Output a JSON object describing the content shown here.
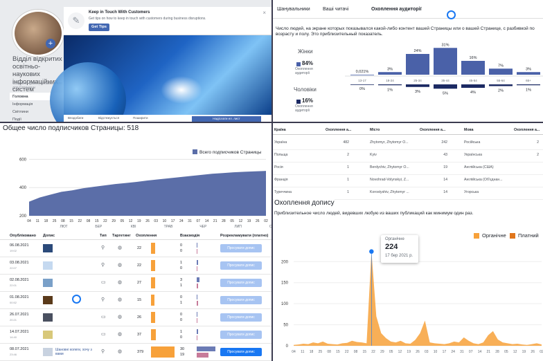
{
  "fb_page": {
    "name": "Відділ відкритих освітньо-наукових інформаційних систем",
    "handle": "Создайте @имя_пользователя для Страницы",
    "nav": [
      "Головна",
      "Інформація",
      "Світлини",
      "Події"
    ],
    "tip": {
      "title": "Keep in Touch With Customers",
      "subtitle": "Get tips on how to keep in touch with customers during business disruptions.",
      "button": "Get Tips"
    },
    "actions": [
      "Вподобати",
      "Відстежується",
      "Поширити",
      "Надіслати ел. лист"
    ],
    "avatar_badge": "+"
  },
  "audience": {
    "tabs": [
      "Шанувальники",
      "Ваші читачі",
      "Охоплення аудиторії"
    ],
    "description": "Число людей, на экране которых показывался какой-либо контент вашей Страницы или о вашей Странице, с разбивкой по возрасту и полу. Это приблизительный показатель.",
    "women": {
      "label": "Жінки",
      "pct": "84%",
      "sub": "Охоплення аудиторії"
    },
    "men": {
      "label": "Чоловіки",
      "pct": "16%",
      "sub": "Охоплення аудиторії"
    },
    "age_groups": [
      "13-17",
      "18-24",
      "25-34",
      "35-44",
      "45-54",
      "55-64",
      "65+"
    ],
    "women_values": [
      "0,021%",
      "3%",
      "24%",
      "31%",
      "16%",
      "7%",
      "3%"
    ],
    "women_nums": [
      0.021,
      3,
      24,
      31,
      16,
      7,
      3
    ],
    "men_values": [
      "0%",
      "1%",
      "3%",
      "5%",
      "4%",
      "2%",
      "1%"
    ],
    "men_nums": [
      0,
      1,
      3,
      5,
      4,
      2,
      1
    ],
    "women_color": "#4a61a8",
    "men_color": "#1c2a63"
  },
  "subscribers": {
    "title": "Общее число подписчиков Страницы: 518",
    "legend": "Всего подписчиков Страницы",
    "months": [
      "ЛЮТ",
      "БЕР",
      "КВІ",
      "ТРАВ",
      "ЧЕР",
      "ЛИП",
      "СЕР"
    ],
    "day_ticks": [
      "04",
      "11",
      "18",
      "25",
      "08",
      "15",
      "22",
      "08",
      "15",
      "22",
      "29",
      "05",
      "12",
      "19",
      "26",
      "03",
      "10",
      "17",
      "24",
      "31",
      "07",
      "14",
      "21",
      "28",
      "05",
      "12",
      "19",
      "26",
      "02"
    ],
    "color": "#5b6ea8"
  },
  "chart_data": [
    {
      "type": "area",
      "title": "Общее число подписчиков Страницы: 518",
      "series": [
        {
          "name": "Всего подписчиков Страницы",
          "values": [
            300,
            330,
            350,
            370,
            380,
            395,
            405,
            415,
            425,
            432,
            440,
            450,
            458,
            466,
            474,
            482,
            490,
            498,
            503,
            508,
            512,
            515,
            518
          ]
        }
      ],
      "ylim": [
        200,
        700
      ],
      "yticks": [
        200,
        400,
        600
      ],
      "legend": "top-right"
    },
    {
      "type": "bar",
      "categories": [
        "13-17",
        "18-24",
        "25-34",
        "35-44",
        "45-54",
        "55-64",
        "65+"
      ],
      "series": [
        {
          "name": "Жінки",
          "values": [
            0.021,
            3,
            24,
            31,
            16,
            7,
            3
          ]
        },
        {
          "name": "Чоловіки",
          "values": [
            0,
            1,
            3,
            5,
            4,
            2,
            1
          ]
        }
      ]
    },
    {
      "type": "area",
      "title": "Охоплення допису",
      "series": [
        {
          "name": "Органічне",
          "values": [
            2,
            3,
            5,
            4,
            8,
            6,
            10,
            5,
            4,
            3,
            6,
            7,
            12,
            9,
            8,
            6,
            224,
            70,
            30,
            18,
            10,
            8,
            12,
            6,
            5,
            14,
            30,
            60,
            8,
            6,
            5,
            4,
            6,
            10,
            8,
            20,
            12,
            6,
            4,
            8,
            25,
            35,
            15,
            8,
            6,
            4,
            5,
            3,
            2,
            4,
            6,
            3
          ]
        },
        {
          "name": "Платний",
          "values": [
            0,
            0,
            0,
            0,
            0,
            0,
            0,
            0,
            0,
            0,
            0,
            0,
            0,
            0,
            0,
            0,
            0,
            0,
            0,
            0,
            0,
            0,
            0,
            0,
            0,
            0,
            0,
            0,
            0,
            0,
            0,
            0,
            0,
            0,
            0,
            0,
            0,
            0,
            0,
            0,
            0,
            0,
            0,
            0,
            0,
            0,
            0,
            0,
            0,
            0,
            0,
            0
          ]
        }
      ],
      "ylim": [
        0,
        230
      ],
      "yticks": [
        0,
        50,
        100,
        150,
        200
      ],
      "legend": "top-right"
    }
  ],
  "posts": {
    "headers": [
      "Опубліковано",
      "Допис",
      "Тип",
      "Таргетинг",
      "Охоплення",
      "Взаємодія",
      "Розрекламувати (платно)"
    ],
    "boost_label": "Просувати допис",
    "rows": [
      {
        "date": "06.08.2021",
        "time": "19:02",
        "reach": "22",
        "reach_frac": 0.06,
        "eng": [
          "0",
          "0"
        ],
        "eng_frac": [
          0,
          0
        ],
        "type": "link",
        "thumb": "#2b4a7a"
      },
      {
        "date": "03.08.2021",
        "time": "22:07",
        "reach": "22",
        "reach_frac": 0.06,
        "eng": [
          "1",
          "0"
        ],
        "eng_frac": [
          0.04,
          0
        ],
        "type": "link",
        "thumb": "#c5d9f0"
      },
      {
        "date": "02.08.2021",
        "time": "22:01",
        "reach": "27",
        "reach_frac": 0.07,
        "eng": [
          "3",
          "1"
        ],
        "eng_frac": [
          0.1,
          0.04
        ],
        "type": "photo",
        "thumb": "#7aa0c8"
      },
      {
        "date": "01.08.2021",
        "time": "00:52",
        "reach": "15",
        "reach_frac": 0.04,
        "eng": [
          "0",
          "1"
        ],
        "eng_frac": [
          0,
          0.04
        ],
        "type": "link",
        "thumb": "#5a3a1a"
      },
      {
        "date": "26.07.2021",
        "time": "20:21",
        "reach": "26",
        "reach_frac": 0.07,
        "eng": [
          "0",
          "0"
        ],
        "eng_frac": [
          0,
          0
        ],
        "type": "photo",
        "thumb": "#4a5060"
      },
      {
        "date": "14.07.2021",
        "time": "14:40",
        "reach": "37",
        "reach_frac": 0.1,
        "eng": [
          "1",
          "0"
        ],
        "eng_frac": [
          0.04,
          0
        ],
        "type": "photo",
        "thumb": "#d8c87a"
      },
      {
        "date": "08.07.2021",
        "time": "23:46",
        "reach": "379",
        "reach_frac": 1.0,
        "eng": [
          "30",
          "19"
        ],
        "eng_frac": [
          1.0,
          0.6
        ],
        "type": "link",
        "thumb": "#c8d2e0",
        "text": "Шановні колеги, хочу з вами"
      }
    ]
  },
  "geo": {
    "headers": [
      "Країна",
      "Охоплення а...",
      "Місто",
      "Охоплення а...",
      "Мова",
      "Охоплення а..."
    ],
    "rows": [
      [
        "Україна",
        "482",
        "Zhytomyr, Zhytomyr O...",
        "242",
        "Російська",
        "2"
      ],
      [
        "Польща",
        "2",
        "Kyiv",
        "43",
        "Українська",
        "2"
      ],
      [
        "Росія",
        "1",
        "Berdychiv, Zhytomyr O...",
        "19",
        "Англійська (США)",
        ""
      ],
      [
        "Франція",
        "1",
        "Novohrad-Volynskyi, Z...",
        "14",
        "Англійська (Об'єднан...",
        ""
      ],
      [
        "Туреччина",
        "1",
        "Korostyshiv, Zhytomyr ...",
        "14",
        "Угорська",
        ""
      ]
    ]
  },
  "reach": {
    "title": "Охоплення допису",
    "description": "Приблизительное число людей, видевших любую из ваших публикаций как минимум один раз.",
    "legend": [
      "Органічне",
      "Платний"
    ],
    "colors": [
      "#f7a13a",
      "#e0761c"
    ],
    "tooltip": {
      "label": "Органічне",
      "value": "224",
      "date": "17 бер 2021 р."
    }
  }
}
